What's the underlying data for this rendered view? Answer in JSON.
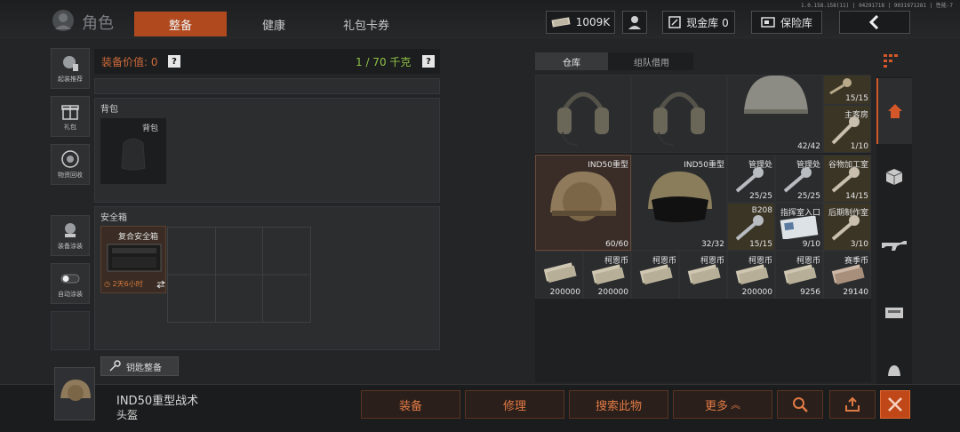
{
  "version": "1.0.158.158(11) | 04291718 | 9031971281 | 性能-7",
  "header": {
    "title": "角色",
    "tabs": [
      {
        "label": "整备",
        "active": true
      },
      {
        "label": "健康",
        "active": false
      },
      {
        "label": "礼包卡券",
        "active": false
      }
    ],
    "money": "1009K",
    "cash_vault": "现金库 0",
    "safe_vault": "保险库"
  },
  "side": {
    "items": [
      {
        "label": "起装推荐",
        "icon": "outfit-recommend-icon"
      },
      {
        "label": "礼包",
        "icon": "gift-icon"
      },
      {
        "label": "物资回收",
        "icon": "recycle-icon"
      },
      {
        "label": "装备涂装",
        "icon": "paint-icon"
      },
      {
        "label": "自动涂装",
        "icon": "toggle-icon"
      }
    ]
  },
  "loadout": {
    "value_label": "装备价值: 0",
    "weight": "1 / 70 千克",
    "bag_section": "背包",
    "bag_slot": "背包",
    "safe_section": "安全箱",
    "safe_item": "复合安全箱",
    "safe_timer": "2天6小时",
    "key_sort": "钥匙整备"
  },
  "warehouse": {
    "tabs": [
      {
        "label": "仓库",
        "active": true
      },
      {
        "label": "组队借用",
        "active": false
      }
    ],
    "row1": [
      {
        "kind": "headset",
        "label": "",
        "count": ""
      },
      {
        "kind": "headset",
        "label": "",
        "count": ""
      },
      {
        "kind": "helmet",
        "label": "",
        "count": "42/42"
      },
      {
        "kind": "key",
        "label": "",
        "count": "15/15"
      },
      {
        "kind": "key",
        "label": "主客房",
        "count": "1/10"
      }
    ],
    "big": [
      {
        "kind": "helmet",
        "label": "IND50重型",
        "count": "60/60",
        "selected": true
      },
      {
        "kind": "helmet-visor",
        "label": "IND50重型",
        "count": "32/32",
        "selected": false
      }
    ],
    "keys": [
      {
        "label": "管理处",
        "count": "25/25",
        "plus": true
      },
      {
        "label": "管理处",
        "count": "25/25",
        "plus": true
      },
      {
        "label": "谷物加工室",
        "count": "14/15",
        "plus": false
      },
      {
        "label": "B208",
        "count": "15/15",
        "plus": false
      },
      {
        "label": "指挥室入口",
        "count": "9/10",
        "plus": false
      },
      {
        "label": "后期制作室",
        "count": "3/10",
        "plus": false
      }
    ],
    "cash": [
      {
        "label": "",
        "count": "200000"
      },
      {
        "label": "柯恩币",
        "count": "200000"
      },
      {
        "label": "柯恩币",
        "count": ""
      },
      {
        "label": "柯恩币",
        "count": ""
      },
      {
        "label": "柯恩币",
        "count": "200000"
      },
      {
        "label": "柯恩币",
        "count": "9256"
      },
      {
        "label": "赛季币",
        "count": "29140"
      }
    ]
  },
  "selected_item": {
    "name": "IND50重型战术",
    "type": "头盔"
  },
  "actions": {
    "equip": "装备",
    "repair": "修理",
    "search": "搜索此物",
    "more": "更多"
  },
  "colors": {
    "accent": "#b04a1e",
    "weight_green": "#8fc146",
    "action_orange": "#e07a45"
  }
}
